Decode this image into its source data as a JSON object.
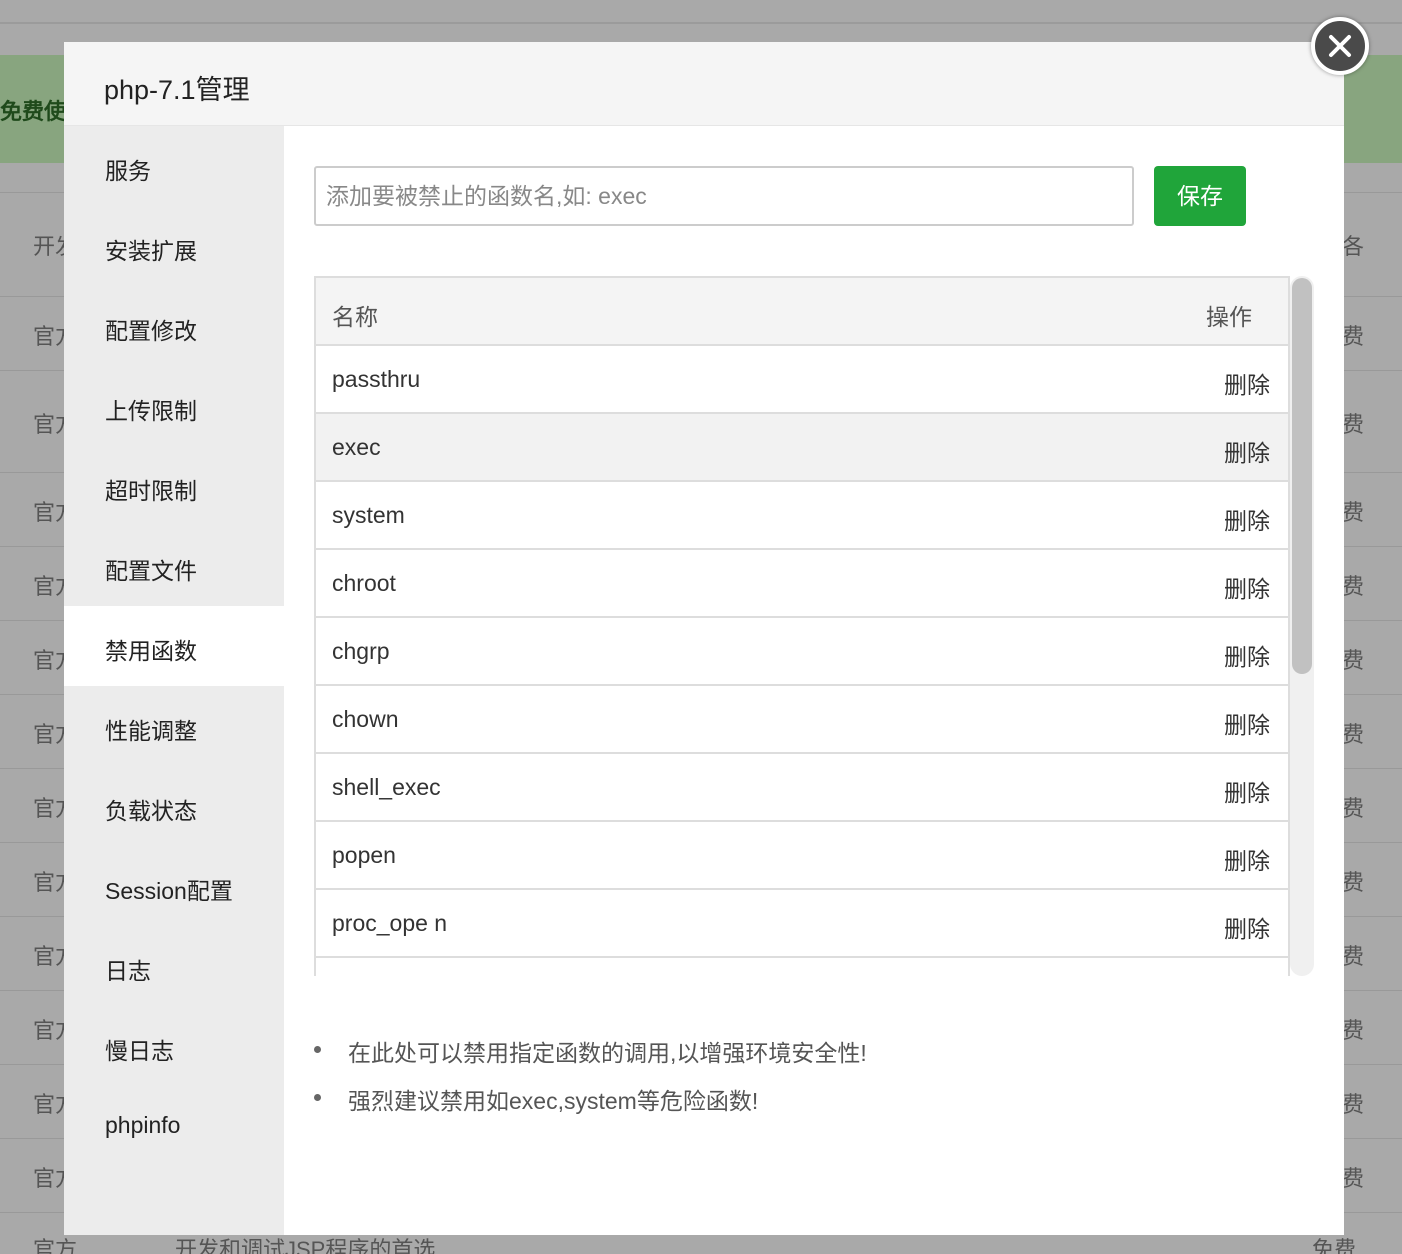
{
  "background": {
    "banner_text": "免费使",
    "header_left": "开发",
    "header_right": "各",
    "row_left": "官方",
    "row_right": "费",
    "bottom_left": "官方",
    "bottom_desc": "开发和调试JSP程序的首选",
    "bottom_right": "免费"
  },
  "modal": {
    "title": "php-7.1管理",
    "close_icon": "close-icon"
  },
  "sidebar": {
    "items": [
      {
        "label": "服务"
      },
      {
        "label": "安装扩展"
      },
      {
        "label": "配置修改"
      },
      {
        "label": "上传限制"
      },
      {
        "label": "超时限制"
      },
      {
        "label": "配置文件"
      },
      {
        "label": "禁用函数",
        "active": true
      },
      {
        "label": "性能调整"
      },
      {
        "label": "负载状态"
      },
      {
        "label": "Session配置"
      },
      {
        "label": "日志"
      },
      {
        "label": "慢日志"
      },
      {
        "label": "phpinfo"
      }
    ]
  },
  "form": {
    "input_placeholder": "添加要被禁止的函数名,如: exec",
    "input_value": "",
    "save_label": "保存"
  },
  "table": {
    "col_name": "名称",
    "col_op": "操作",
    "rows": [
      {
        "name": "passthru",
        "op": "删除"
      },
      {
        "name": "exec",
        "op": "删除"
      },
      {
        "name": "system",
        "op": "删除"
      },
      {
        "name": "chroot",
        "op": "删除"
      },
      {
        "name": "chgrp",
        "op": "删除"
      },
      {
        "name": "chown",
        "op": "删除"
      },
      {
        "name": "shell_exec",
        "op": "删除"
      },
      {
        "name": "popen",
        "op": "删除"
      },
      {
        "name": "proc_ope n",
        "op": "删除"
      }
    ]
  },
  "tips": [
    "在此处可以禁用指定函数的调用,以增强环境安全性!",
    "强烈建议禁用如exec,system等危险函数!"
  ],
  "colors": {
    "accent": "#20a53a",
    "banner_bg": "#88a57f"
  }
}
